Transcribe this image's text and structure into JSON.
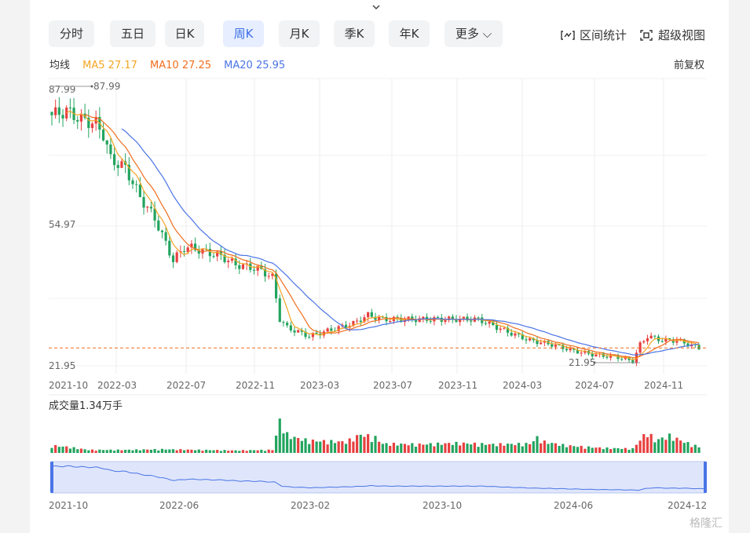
{
  "toolbar": {
    "tabs": [
      "分时",
      "五日",
      "日K",
      "周K",
      "月K",
      "季K",
      "年K",
      "更多"
    ],
    "active_tab": "周K",
    "range_stats_label": "区间统计",
    "super_view_label": "超级视图"
  },
  "indicators": {
    "label": "均线",
    "ma5": "MA5 27.17",
    "ma10": "MA10 27.25",
    "ma20": "MA20 25.95",
    "adjust": "前复权",
    "colors": {
      "ma5": "#f5a623",
      "ma10": "#f06e1e",
      "ma20": "#4a74e6",
      "up": "#e84040",
      "down": "#23a45f"
    }
  },
  "volume_label": "成交量1.34万手",
  "watermark": "格隆汇",
  "chart_data": {
    "type": "candlestick",
    "price_axis": {
      "top_label": "87.99",
      "mid_label": "54.97",
      "bottom_label": "21.95",
      "ylim": [
        21.95,
        87.99
      ]
    },
    "markers": {
      "max": "87.99",
      "min": "21.95"
    },
    "last_price_line": 26.2,
    "x_ticks": [
      "2021-10",
      "2022-03",
      "2022-07",
      "2022-11",
      "2023-03",
      "2023-07",
      "2023-11",
      "2024-03",
      "2024-07",
      "2024-11"
    ],
    "navigator_ticks": [
      "2021-10",
      "2022-06",
      "2023-02",
      "2023-10",
      "2024-06",
      "2024-12"
    ],
    "close_anchors": [
      [
        0,
        81.5
      ],
      [
        4,
        82.5
      ],
      [
        8,
        80.5
      ],
      [
        12,
        79.5
      ],
      [
        14,
        77
      ],
      [
        16,
        71
      ],
      [
        20,
        69
      ],
      [
        24,
        62
      ],
      [
        28,
        57
      ],
      [
        31,
        51
      ],
      [
        33,
        47
      ],
      [
        36,
        50
      ],
      [
        38,
        50
      ],
      [
        42,
        49
      ],
      [
        46,
        48
      ],
      [
        50,
        46
      ],
      [
        56,
        45
      ],
      [
        60,
        43
      ],
      [
        62,
        33
      ],
      [
        64,
        31
      ],
      [
        70,
        29
      ],
      [
        74,
        30
      ],
      [
        78,
        31
      ],
      [
        82,
        32
      ],
      [
        86,
        34
      ],
      [
        90,
        33
      ],
      [
        98,
        33
      ],
      [
        110,
        33
      ],
      [
        116,
        33
      ],
      [
        124,
        30
      ],
      [
        130,
        28
      ],
      [
        136,
        27
      ],
      [
        142,
        25.5
      ],
      [
        148,
        24.5
      ],
      [
        154,
        24
      ],
      [
        158,
        23
      ],
      [
        160,
        27
      ],
      [
        162,
        29
      ],
      [
        166,
        28
      ],
      [
        170,
        28
      ],
      [
        176,
        26.2
      ]
    ],
    "weeks": 177,
    "volume_anchors": [
      [
        0,
        12
      ],
      [
        4,
        10
      ],
      [
        10,
        5
      ],
      [
        20,
        5
      ],
      [
        30,
        6
      ],
      [
        40,
        5
      ],
      [
        50,
        4
      ],
      [
        60,
        5
      ],
      [
        62,
        52
      ],
      [
        64,
        30
      ],
      [
        66,
        25
      ],
      [
        70,
        20
      ],
      [
        80,
        18
      ],
      [
        84,
        30
      ],
      [
        88,
        25
      ],
      [
        90,
        15
      ],
      [
        100,
        14
      ],
      [
        110,
        16
      ],
      [
        120,
        14
      ],
      [
        130,
        15
      ],
      [
        132,
        25
      ],
      [
        134,
        18
      ],
      [
        140,
        12
      ],
      [
        150,
        8
      ],
      [
        158,
        7
      ],
      [
        162,
        35
      ],
      [
        164,
        20
      ],
      [
        168,
        28
      ],
      [
        172,
        18
      ],
      [
        176,
        10
      ]
    ],
    "volume_max": 60
  }
}
